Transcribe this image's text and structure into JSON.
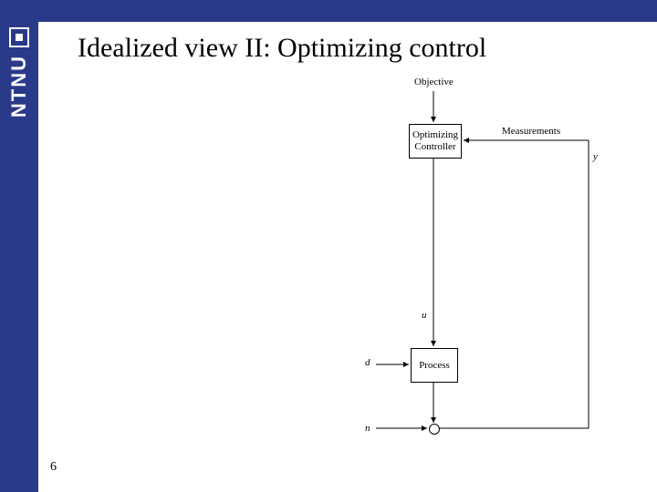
{
  "slide": {
    "title": "Idealized view II: Optimizing control",
    "page_number": "6"
  },
  "logo": {
    "brand_text": "NTNU"
  },
  "diagram": {
    "labels": {
      "objective": "Objective",
      "measurements": "Measurements",
      "controller": "Optimizing\nController",
      "process": "Process",
      "u": "u",
      "d": "d",
      "y": "y",
      "n": "n"
    }
  }
}
